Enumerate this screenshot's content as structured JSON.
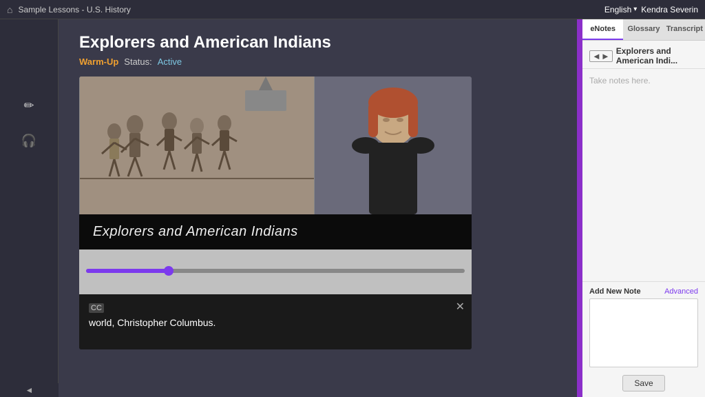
{
  "topbar": {
    "breadcrumb": "Sample Lessons - U.S. History",
    "language": "English",
    "username": "Kendra Severin"
  },
  "lesson": {
    "title": "Explorers and American Indians",
    "warm_up_label": "Warm-Up",
    "status_label": "Status:",
    "status_value": "Active",
    "video_title_overlay": "Explorers and American Indians"
  },
  "caption": {
    "icon_label": "CC",
    "text": "world, Christopher Columbus.",
    "close_icon": "✕"
  },
  "tabs": {
    "enotes": "eNotes",
    "glossary": "Glossary",
    "transcript": "Transcript"
  },
  "notes_panel": {
    "collapse_label": "◄►",
    "title": "Explorers and American Indi...",
    "placeholder": "Take notes here.",
    "add_note_label": "Add New Note",
    "advanced_label": "Advanced",
    "save_label": "Save"
  },
  "sidebar": {
    "pencil_icon": "✏",
    "headphone_icon": "🎧"
  },
  "icons": {
    "home": "⌂",
    "chevron_down": "▾",
    "close": "✕",
    "back_arrow": "◄"
  }
}
